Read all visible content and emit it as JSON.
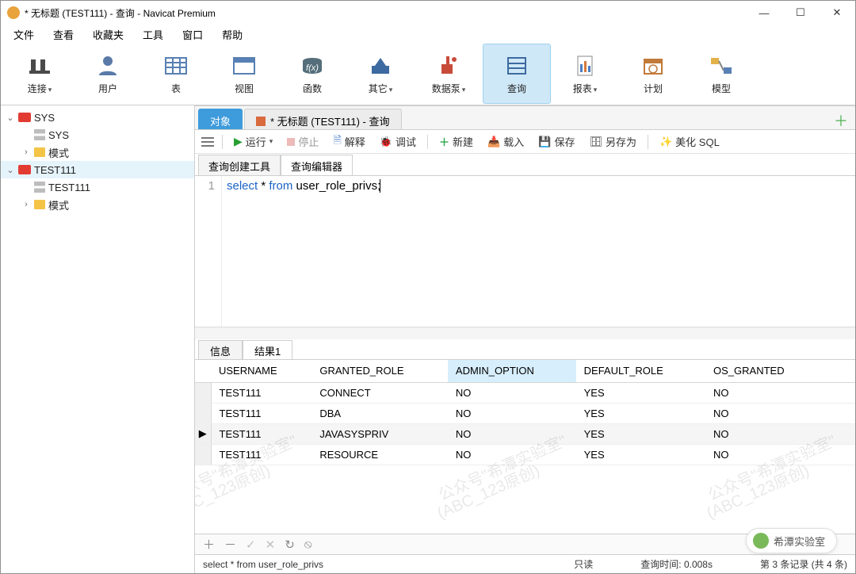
{
  "title": "* 无标题 (TEST111) - 查询 - Navicat Premium",
  "menu": [
    "文件",
    "查看",
    "收藏夹",
    "工具",
    "窗口",
    "帮助"
  ],
  "toolbar": [
    {
      "label": "连接",
      "id": "connect"
    },
    {
      "label": "用户",
      "id": "user"
    },
    {
      "label": "表",
      "id": "table"
    },
    {
      "label": "视图",
      "id": "view"
    },
    {
      "label": "函数",
      "id": "function"
    },
    {
      "label": "其它",
      "id": "other"
    },
    {
      "label": "数据泵",
      "id": "datapump"
    },
    {
      "label": "查询",
      "id": "query",
      "active": true
    },
    {
      "label": "报表",
      "id": "report"
    },
    {
      "label": "计划",
      "id": "schedule"
    },
    {
      "label": "模型",
      "id": "model"
    }
  ],
  "tree": {
    "sys": {
      "name": "SYS",
      "children": [
        {
          "name": "SYS",
          "type": "table"
        },
        {
          "name": "模式",
          "type": "folder"
        }
      ]
    },
    "test": {
      "name": "TEST111",
      "children": [
        {
          "name": "TEST111",
          "type": "table"
        },
        {
          "name": "模式",
          "type": "folder"
        }
      ]
    }
  },
  "tabs": {
    "obj": "对象",
    "query": "* 无标题 (TEST111) - 查询"
  },
  "actions": {
    "run": "运行",
    "stop": "停止",
    "explain": "解释",
    "debug": "调试",
    "new": "新建",
    "load": "载入",
    "save": "保存",
    "saveas": "另存为",
    "beautify": "美化 SQL"
  },
  "subtabs": {
    "builder": "查询创建工具",
    "editor": "查询编辑器"
  },
  "sql": {
    "line": "1",
    "kw1": "select",
    "star": "*",
    "kw2": "from",
    "tbl": "user_role_privs",
    "semi": ";"
  },
  "restabs": {
    "info": "信息",
    "result": "结果1"
  },
  "columns": [
    "USERNAME",
    "GRANTED_ROLE",
    "ADMIN_OPTION",
    "DEFAULT_ROLE",
    "OS_GRANTED"
  ],
  "rows": [
    {
      "u": "TEST111",
      "g": "CONNECT",
      "a": "NO",
      "d": "YES",
      "o": "NO"
    },
    {
      "u": "TEST111",
      "g": "DBA",
      "a": "NO",
      "d": "YES",
      "o": "NO"
    },
    {
      "u": "TEST111",
      "g": "JAVASYSPRIV",
      "a": "NO",
      "d": "YES",
      "o": "NO",
      "cur": true
    },
    {
      "u": "TEST111",
      "g": "RESOURCE",
      "a": "NO",
      "d": "YES",
      "o": "NO"
    }
  ],
  "status": {
    "sql": "select * from user_role_privs",
    "mode": "只读",
    "time": "查询时间: 0.008s",
    "rec": "第 3 条记录 (共 4 条)"
  },
  "watermark": "希潭实验室",
  "wm_lines": [
    "公众号\"希潭实验室\"",
    "(ABC_123原创)"
  ]
}
